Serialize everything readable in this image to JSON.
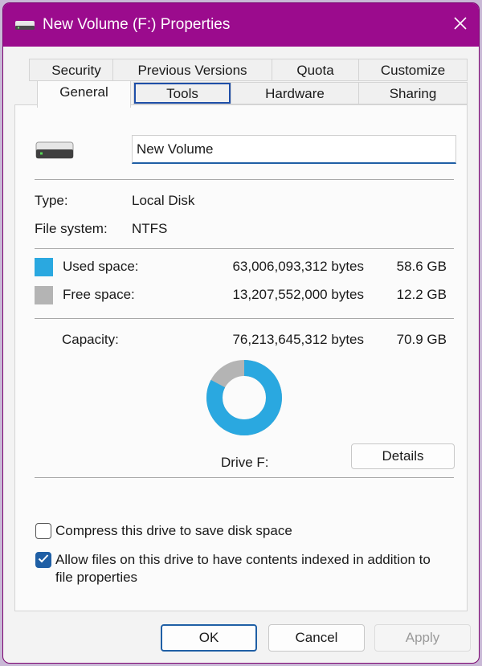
{
  "window": {
    "title": "New Volume (F:) Properties",
    "title_bar_color": "#9b0b8d",
    "icons": {
      "title": "drive-icon",
      "close": "close-icon"
    }
  },
  "tabs": {
    "row1": [
      "Security",
      "Previous Versions",
      "Quota",
      "Customize"
    ],
    "row2": [
      "General",
      "Tools",
      "Hardware",
      "Sharing"
    ],
    "active": "General",
    "focused": "Tools"
  },
  "general": {
    "volume_name": "New Volume",
    "type_label": "Type:",
    "type_value": "Local Disk",
    "fs_label": "File system:",
    "fs_value": "NTFS",
    "used": {
      "label": "Used space:",
      "bytes": "63,006,093,312 bytes",
      "size": "58.6 GB",
      "color": "#2aa8e0"
    },
    "free": {
      "label": "Free space:",
      "bytes": "13,207,552,000 bytes",
      "size": "12.2 GB",
      "color": "#b4b4b4"
    },
    "capacity": {
      "label": "Capacity:",
      "bytes": "76,213,645,312 bytes",
      "size": "70.9 GB"
    },
    "used_fraction": 0.8267,
    "drive_label": "Drive F:",
    "details_button": "Details",
    "compress_label": "Compress this drive to save disk space",
    "compress_checked": false,
    "index_label_line1": "Allow files on this drive to have contents indexed in addition to",
    "index_label_line2": "file properties",
    "index_checked": true
  },
  "buttons": {
    "ok": "OK",
    "cancel": "Cancel",
    "apply": "Apply"
  }
}
